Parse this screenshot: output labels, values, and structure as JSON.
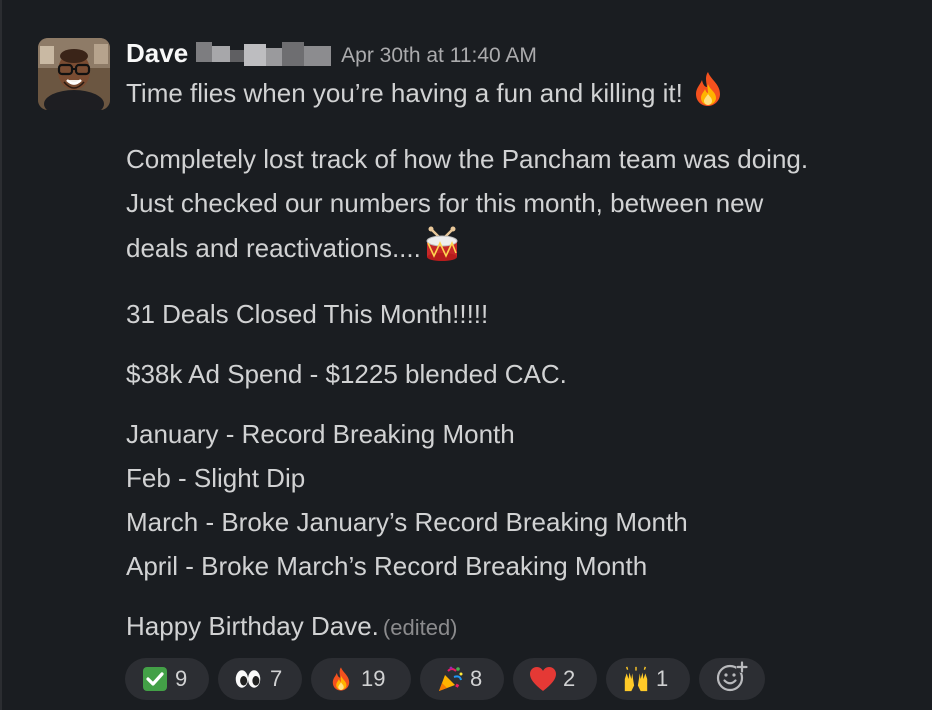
{
  "message": {
    "author": "Dave",
    "timestamp": "Apr 30th at 11:40 AM",
    "paragraphs": {
      "p1": "Time flies when you’re having a fun and killing it!",
      "p2_line1": "Completely lost track of how the Pancham team was doing.",
      "p2_line2": "Just checked our numbers for this month, between new",
      "p2_line3": "deals and reactivations....",
      "p3": "31 Deals Closed This Month!!!!!",
      "p4": "$38k Ad Spend - $1225 blended CAC.",
      "p5_line1": "January - Record Breaking Month",
      "p5_line2": "Feb - Slight Dip",
      "p5_line3": "March - Broke January’s Record Breaking Month",
      "p5_line4": "April - Broke March’s Record Breaking Month",
      "p6": "Happy Birthday Dave."
    },
    "edited_label": "(edited)",
    "inline_emojis": [
      "fire-icon",
      "drum-icon"
    ]
  },
  "reactions": [
    {
      "icon": "check-mark-icon",
      "count": "9"
    },
    {
      "icon": "eyes-icon",
      "count": "7"
    },
    {
      "icon": "fire-icon",
      "count": "19"
    },
    {
      "icon": "party-popper-icon",
      "count": "8"
    },
    {
      "icon": "red-heart-icon",
      "count": "2"
    },
    {
      "icon": "raised-hands-icon",
      "count": "1"
    }
  ],
  "add_reaction": {
    "icon": "add-reaction-icon"
  },
  "colors": {
    "background": "#1a1d21",
    "text": "#d1d2d3",
    "author": "#f8f8f8",
    "timestamp": "#ababad",
    "reaction_bg": "#2c2e33"
  }
}
